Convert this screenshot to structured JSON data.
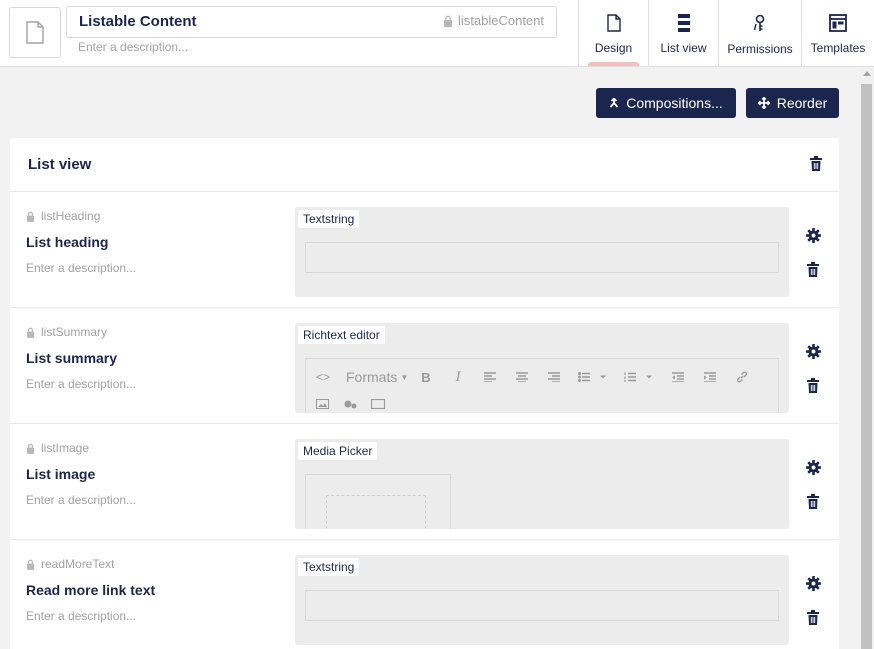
{
  "header": {
    "name": "Listable Content",
    "alias": "listableContent",
    "description_placeholder": "Enter a description...",
    "tabs": [
      {
        "label": "Design",
        "icon": "document-icon",
        "active": true
      },
      {
        "label": "List view",
        "icon": "list-icon",
        "active": false
      },
      {
        "label": "Permissions",
        "icon": "keys-icon",
        "active": false
      },
      {
        "label": "Templates",
        "icon": "layout-icon",
        "active": false
      }
    ]
  },
  "actions": {
    "compositions": "Compositions...",
    "reorder": "Reorder"
  },
  "group": {
    "title": "List view",
    "properties": [
      {
        "alias": "listHeading",
        "name": "List heading",
        "description": "Enter a description...",
        "editor": "Textstring"
      },
      {
        "alias": "listSummary",
        "name": "List summary",
        "description": "Enter a description...",
        "editor": "Richtext editor",
        "formats_label": "Formats"
      },
      {
        "alias": "listImage",
        "name": "List image",
        "description": "Enter a description...",
        "editor": "Media Picker"
      },
      {
        "alias": "readMoreText",
        "name": "Read more link text",
        "description": "Enter a description...",
        "editor": "Textstring"
      }
    ]
  },
  "colors": {
    "primary": "#1b264f",
    "muted": "#a2a1a6",
    "active_tab_indicator": "#f5c1bc",
    "background": "#f3f2f2"
  }
}
